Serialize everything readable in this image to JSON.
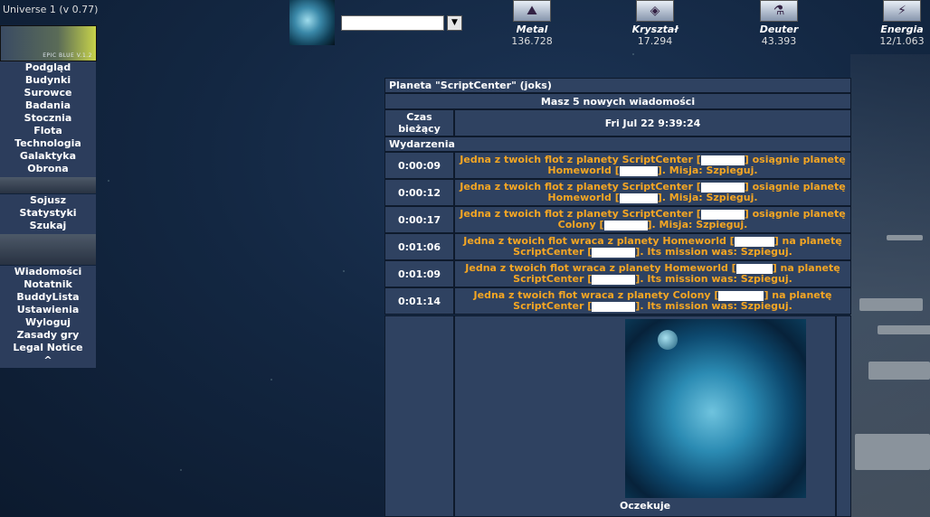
{
  "universe": "Universe 1 (v 0.77)",
  "logo_text": "EPIC BLUE V.1.2",
  "menu": {
    "group1": [
      "Podgląd",
      "Budynki",
      "Surowce",
      "Badania",
      "Stocznia",
      "Flota",
      "Technologia",
      "Galaktyka",
      "Obrona"
    ],
    "group2": [
      "Sojusz",
      "Statystyki",
      "Szukaj"
    ],
    "group3": [
      "Wiadomości",
      "Notatnik",
      "BuddyLista",
      "Ustawienia",
      "Wyloguj",
      "Zasady gry",
      "Legal Notice",
      "^"
    ]
  },
  "planet_select": {
    "value": "",
    "arrow": "▼"
  },
  "resources": [
    {
      "name": "Metal",
      "value": "136.728",
      "icon": "metal-icon",
      "glyph": "⛰"
    },
    {
      "name": "Kryształ",
      "value": "17.294",
      "icon": "crystal-icon",
      "glyph": "◈"
    },
    {
      "name": "Deuter",
      "value": "43.393",
      "icon": "deuterium-icon",
      "glyph": "⚗"
    },
    {
      "name": "Energia",
      "value": "12/1.063",
      "icon": "energy-icon",
      "glyph": "⚡"
    }
  ],
  "overview": {
    "title": "Planeta \"ScriptCenter\" (joks)",
    "messages_notice": "Masz 5 nowych wiadomości",
    "time_label": "Czas bieżący",
    "time_value": "Fri Jul 22 9:39:24",
    "events_header": "Wydarzenia",
    "events": [
      {
        "time": "0:00:09",
        "parts": [
          "Jedna z twoich flot z planety ScriptCenter [",
          "] osiągnie planetę Homeworld [",
          "]. Misja: Szpieguj."
        ]
      },
      {
        "time": "0:00:12",
        "parts": [
          "Jedna z twoich flot z planety ScriptCenter [",
          "] osiągnie planetę Homeworld [",
          "]. Misja: Szpieguj."
        ]
      },
      {
        "time": "0:00:17",
        "parts": [
          "Jedna z twoich flot z planety ScriptCenter [",
          "] osiągnie planetę Colony [",
          "]. Misja: Szpieguj."
        ]
      },
      {
        "time": "0:01:06",
        "parts": [
          "Jedna z twoich flot wraca z planety Homeworld [",
          "] na planetę ScriptCenter [",
          "]. Its mission was: Szpieguj."
        ]
      },
      {
        "time": "0:01:09",
        "parts": [
          "Jedna z twoich flot wraca z planety Homeworld [",
          "] na planetę ScriptCenter [",
          "]. Its mission was: Szpieguj."
        ]
      },
      {
        "time": "0:01:14",
        "parts": [
          "Jedna z twoich flot wraca z planety Colony [",
          "] na planetę ScriptCenter [",
          "]. Its mission was: Szpieguj."
        ]
      }
    ],
    "planet_status": "Oczekuje"
  },
  "colors": {
    "menu_bg": "#2c3d5c",
    "row_bg": "#2f4261",
    "event_text": "#f5a623"
  }
}
